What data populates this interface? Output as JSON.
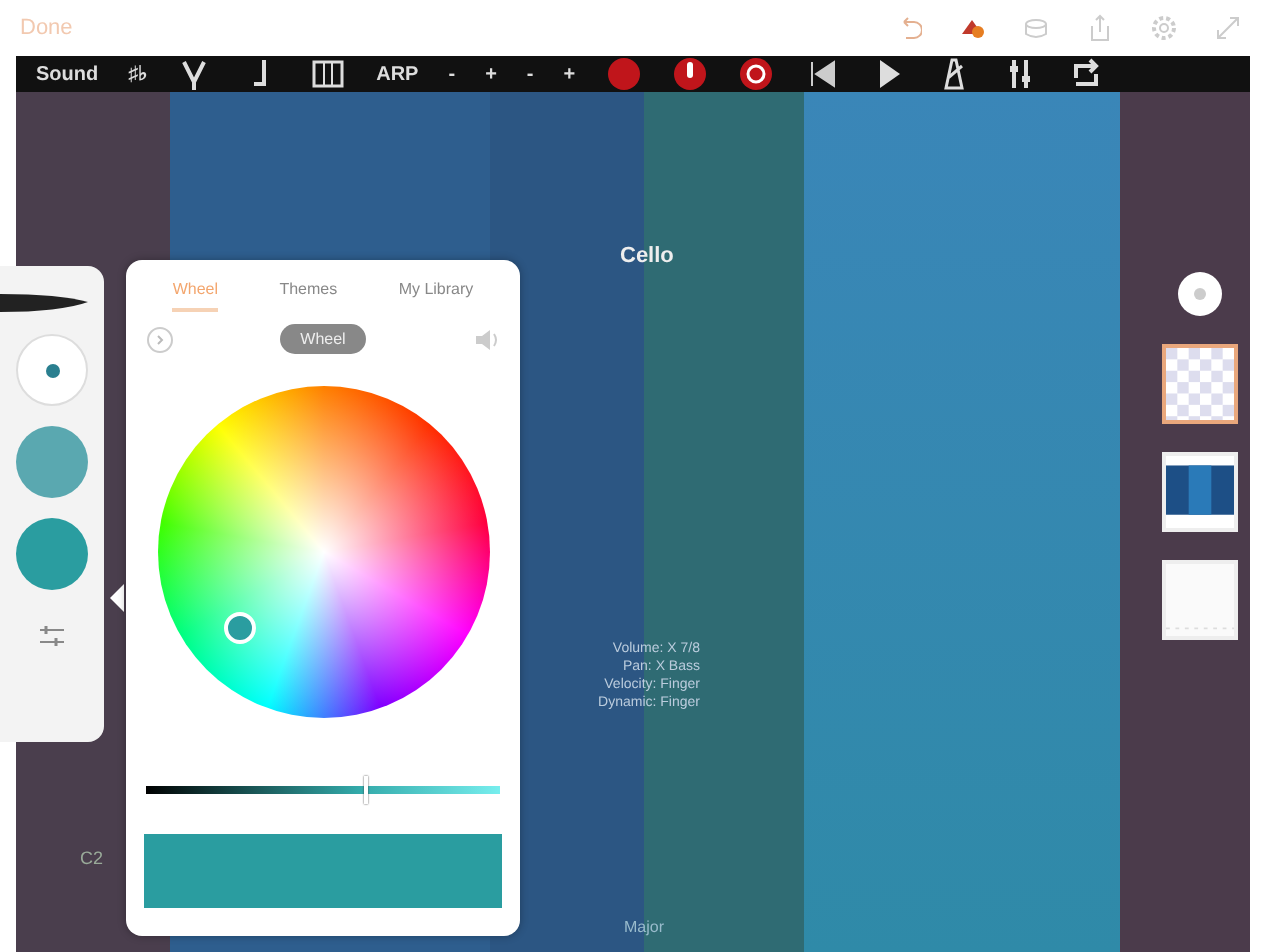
{
  "top_bar": {
    "done": "Done"
  },
  "toolbar": {
    "items": [
      {
        "kind": "text",
        "text": "Sound"
      },
      {
        "kind": "text",
        "text": "♯♭"
      },
      {
        "kind": "tuner"
      },
      {
        "kind": "note"
      },
      {
        "kind": "keys"
      },
      {
        "kind": "text",
        "text": "ARP"
      },
      {
        "kind": "text",
        "text": "-"
      },
      {
        "kind": "text",
        "text": "+"
      },
      {
        "kind": "text",
        "text": "-"
      },
      {
        "kind": "text",
        "text": "+"
      },
      {
        "kind": "record"
      },
      {
        "kind": "mic"
      },
      {
        "kind": "target"
      },
      {
        "kind": "rewind"
      },
      {
        "kind": "play"
      },
      {
        "kind": "metronome"
      },
      {
        "kind": "mixer"
      },
      {
        "kind": "loop"
      }
    ]
  },
  "canvas": {
    "title": "Cello",
    "info": [
      "Volume: X 7/8",
      "Pan: X Bass",
      "Velocity: Finger",
      "Dynamic: Finger"
    ],
    "key_label": "Major",
    "note_label": "C2"
  },
  "color_panel": {
    "tabs": [
      {
        "label": "Wheel",
        "selected": true
      },
      {
        "label": "Themes",
        "selected": false
      },
      {
        "label": "My Library",
        "selected": false
      }
    ],
    "mode": "Wheel",
    "swatch": {
      "color": "#2a9da0"
    },
    "brightness": {
      "level": 0.62
    }
  },
  "layers": [
    {
      "kind": "checker",
      "selected": true
    },
    {
      "kind": "film",
      "selected": false
    },
    {
      "kind": "blank",
      "selected": false
    }
  ]
}
